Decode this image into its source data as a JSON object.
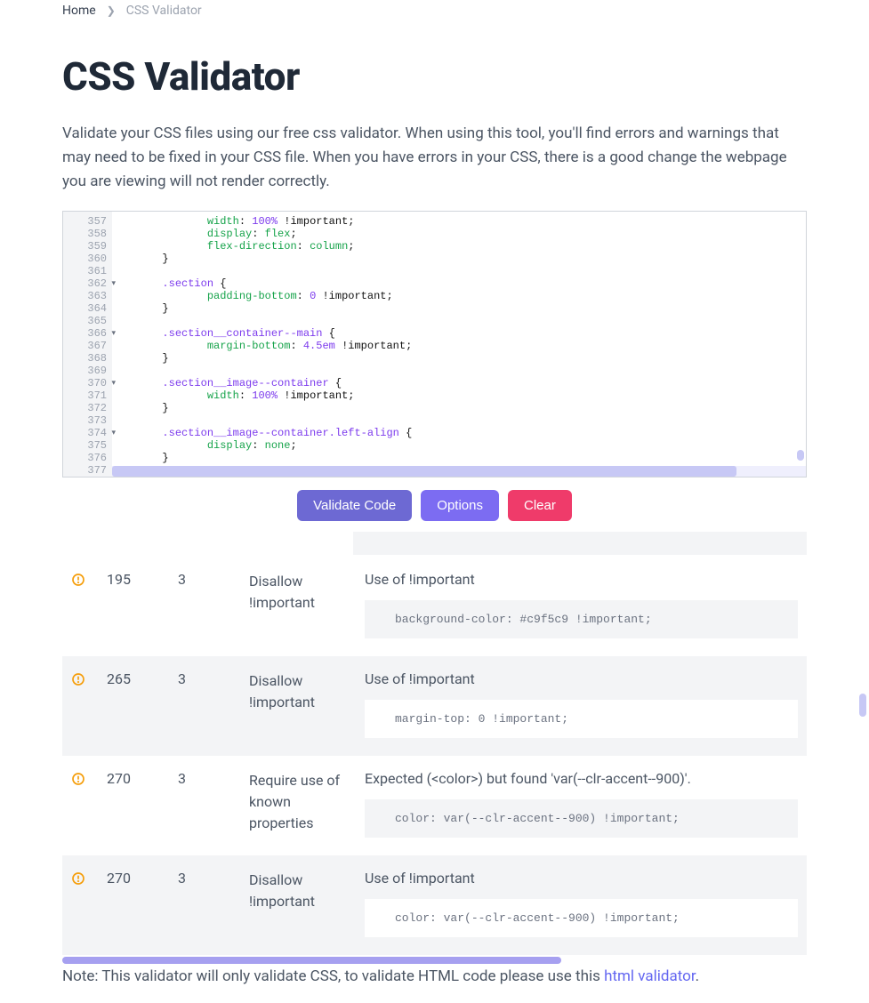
{
  "breadcrumb": {
    "home": "Home",
    "current": "CSS Validator"
  },
  "title": "CSS Validator",
  "intro": "Validate your CSS files using our free css validator. When using this tool, you'll find errors and warnings that may need to be fixed in your CSS file. When you have errors in your CSS, there is a good change the webpage you are viewing will not render correctly.",
  "editor": {
    "lines": [
      {
        "n": "357",
        "in": 2,
        "t": [
          [
            "prop",
            "width"
          ],
          [
            "punct",
            ": "
          ],
          [
            "num",
            "100%"
          ],
          [
            "imp",
            " !important"
          ],
          [
            "punct",
            ";"
          ]
        ]
      },
      {
        "n": "358",
        "in": 2,
        "t": [
          [
            "prop",
            "display"
          ],
          [
            "punct",
            ": "
          ],
          [
            "val",
            "flex"
          ],
          [
            "punct",
            ";"
          ]
        ]
      },
      {
        "n": "359",
        "in": 2,
        "t": [
          [
            "prop",
            "flex-direction"
          ],
          [
            "punct",
            ": "
          ],
          [
            "val",
            "column"
          ],
          [
            "punct",
            ";"
          ]
        ]
      },
      {
        "n": "360",
        "in": 1,
        "t": [
          [
            "punct",
            "}"
          ]
        ]
      },
      {
        "n": "361",
        "in": 0,
        "t": []
      },
      {
        "n": "362",
        "fold": true,
        "in": 1,
        "t": [
          [
            "sel",
            ".section"
          ],
          [
            "punct",
            " {"
          ]
        ]
      },
      {
        "n": "363",
        "in": 2,
        "t": [
          [
            "prop",
            "padding-bottom"
          ],
          [
            "punct",
            ": "
          ],
          [
            "num",
            "0"
          ],
          [
            "imp",
            " !important"
          ],
          [
            "punct",
            ";"
          ]
        ]
      },
      {
        "n": "364",
        "in": 1,
        "t": [
          [
            "punct",
            "}"
          ]
        ]
      },
      {
        "n": "365",
        "in": 0,
        "t": []
      },
      {
        "n": "366",
        "fold": true,
        "in": 1,
        "t": [
          [
            "sel",
            ".section__container--main"
          ],
          [
            "punct",
            " {"
          ]
        ]
      },
      {
        "n": "367",
        "in": 2,
        "t": [
          [
            "prop",
            "margin-bottom"
          ],
          [
            "punct",
            ": "
          ],
          [
            "num",
            "4.5em"
          ],
          [
            "imp",
            " !important"
          ],
          [
            "punct",
            ";"
          ]
        ]
      },
      {
        "n": "368",
        "in": 1,
        "t": [
          [
            "punct",
            "}"
          ]
        ]
      },
      {
        "n": "369",
        "in": 0,
        "t": []
      },
      {
        "n": "370",
        "fold": true,
        "in": 1,
        "t": [
          [
            "sel",
            ".section__image--container"
          ],
          [
            "punct",
            " {"
          ]
        ]
      },
      {
        "n": "371",
        "in": 2,
        "t": [
          [
            "prop",
            "width"
          ],
          [
            "punct",
            ": "
          ],
          [
            "num",
            "100%"
          ],
          [
            "imp",
            " !important"
          ],
          [
            "punct",
            ";"
          ]
        ]
      },
      {
        "n": "372",
        "in": 1,
        "t": [
          [
            "punct",
            "}"
          ]
        ]
      },
      {
        "n": "373",
        "in": 0,
        "t": []
      },
      {
        "n": "374",
        "fold": true,
        "in": 1,
        "t": [
          [
            "sel",
            ".section__image--container.left-align"
          ],
          [
            "punct",
            " {"
          ]
        ]
      },
      {
        "n": "375",
        "in": 2,
        "t": [
          [
            "prop",
            "display"
          ],
          [
            "punct",
            ": "
          ],
          [
            "val",
            "none"
          ],
          [
            "punct",
            ";"
          ]
        ]
      },
      {
        "n": "376",
        "in": 1,
        "t": [
          [
            "punct",
            "}"
          ]
        ]
      },
      {
        "n": "377",
        "in": 0,
        "t": []
      }
    ]
  },
  "buttons": {
    "validate": "Validate Code",
    "options": "Options",
    "clear": "Clear"
  },
  "results": [
    {
      "alt": false,
      "line": "195",
      "col": "3",
      "rule": "Disallow !important",
      "msg": "Use of !important",
      "snippet": "background-color: #c9f5c9 !important;"
    },
    {
      "alt": true,
      "line": "265",
      "col": "3",
      "rule": "Disallow !important",
      "msg": "Use of !important",
      "snippet": "margin-top: 0 !important;"
    },
    {
      "alt": false,
      "line": "270",
      "col": "3",
      "rule": "Require use of known properties",
      "msg": "Expected (<color>) but found 'var(--clr-accent--900)'.",
      "snippet": "color: var(--clr-accent--900) !important;"
    },
    {
      "alt": true,
      "line": "270",
      "col": "3",
      "rule": "Disallow !important",
      "msg": "Use of !important",
      "snippet": "color: var(--clr-accent--900) !important;"
    }
  ],
  "note": {
    "prefix": "Note: This validator will only validate CSS, to validate HTML code please use this ",
    "link": "html validator",
    "suffix": "."
  }
}
